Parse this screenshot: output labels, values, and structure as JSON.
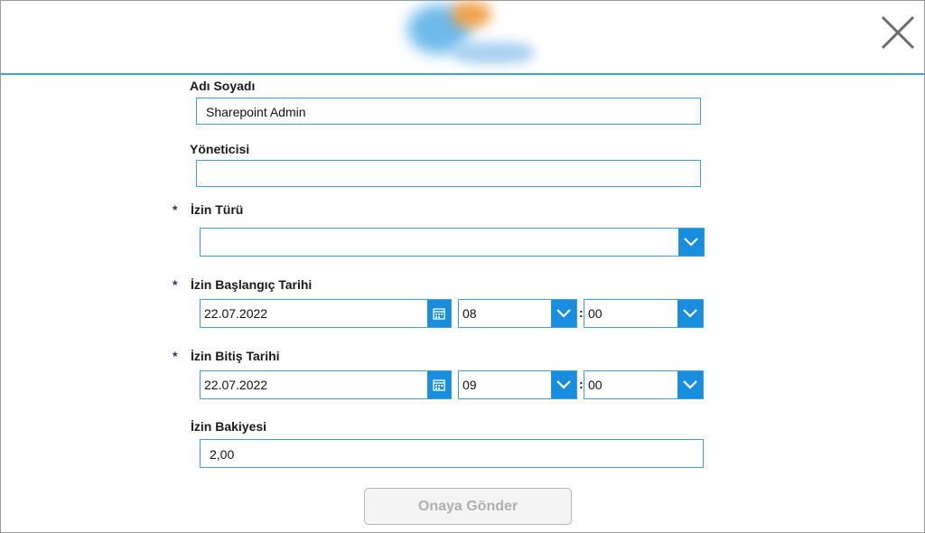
{
  "form": {
    "name_label": "Adı Soyadı",
    "name_value": "Sharepoint Admin",
    "manager_label": "Yöneticisi",
    "manager_value": "",
    "required_mark": "*",
    "leave_type_label": "İzin Türü",
    "leave_type_value": "",
    "start_label": "İzin Başlangıç Tarihi",
    "start_date": "22.07.2022",
    "start_hour": "08",
    "start_minute": "00",
    "end_label": "İzin Bitiş Tarihi",
    "end_date": "22.07.2022",
    "end_hour": "09",
    "end_minute": "00",
    "time_separator": ":",
    "balance_label": "İzin Bakiyesi",
    "balance_value": "2,00",
    "submit_label": "Onaya Gönder"
  },
  "icons": {
    "close": "close-icon",
    "chevron": "chevron-down-icon",
    "calendar": "calendar-icon"
  },
  "colors": {
    "accent": "#1a8ede",
    "border": "#3ea0d9",
    "required": "#1b3a6b"
  }
}
